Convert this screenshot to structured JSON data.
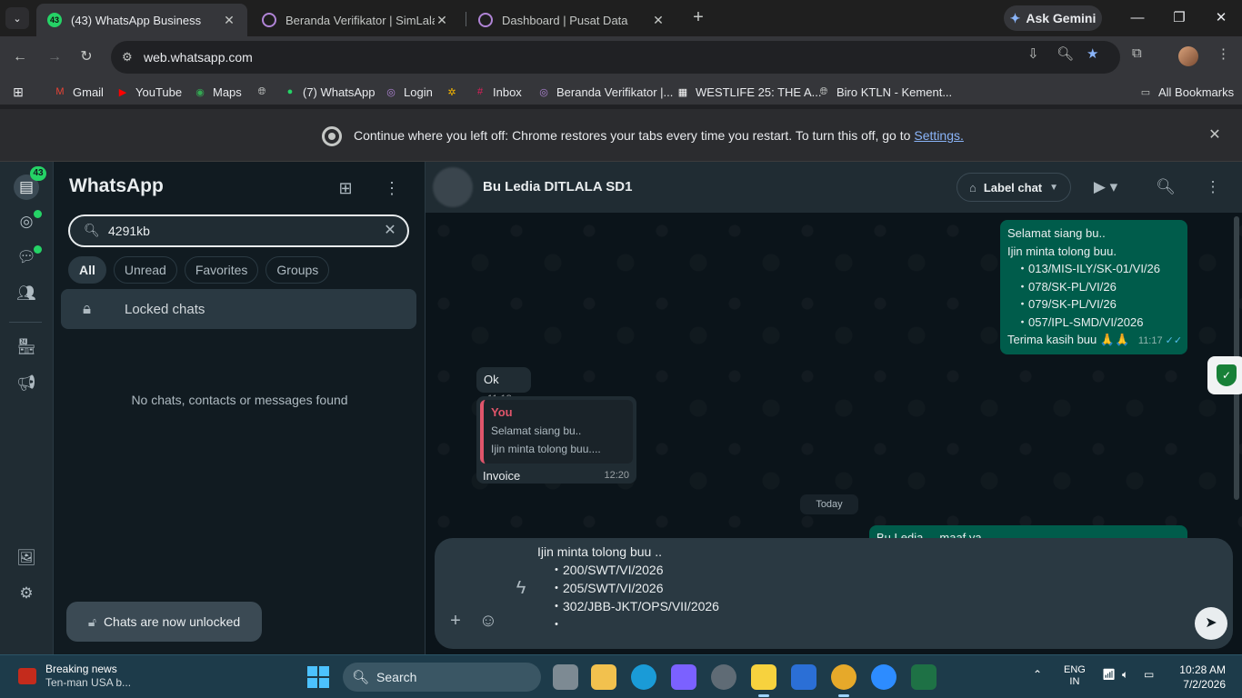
{
  "browser": {
    "tabs": [
      {
        "title": "(43) WhatsApp Business",
        "badge": "43",
        "active": true
      },
      {
        "title": "Beranda Verifikator | SimLala",
        "active": false
      },
      {
        "title": "Dashboard | Pusat Data",
        "active": false
      }
    ],
    "new_tab": "+",
    "ask_gemini": "Ask Gemini",
    "url": "web.whatsapp.com",
    "bookmarks": [
      {
        "label": "Gmail",
        "icon": "gmail-icon",
        "color": "#ea4335"
      },
      {
        "label": "YouTube",
        "icon": "youtube-icon",
        "color": "#ff0000"
      },
      {
        "label": "Maps",
        "icon": "maps-icon",
        "color": "#34a853"
      },
      {
        "label": "",
        "icon": "globe-icon",
        "color": "#c4c7c5"
      },
      {
        "label": "(7) WhatsApp",
        "icon": "whatsapp-icon",
        "color": "#25d366"
      },
      {
        "label": "Login",
        "icon": "simlala-icon",
        "color": "#9c27b0"
      },
      {
        "label": "",
        "icon": "pinwheel-icon",
        "color": "#f4b400"
      },
      {
        "label": "Inbox",
        "icon": "slack-icon",
        "color": "#e01e5a"
      },
      {
        "label": "Beranda Verifikator |...",
        "icon": "simlala-icon",
        "color": "#9c27b0"
      },
      {
        "label": "WESTLIFE 25: THE A...",
        "icon": "ticket-icon",
        "color": "#ffffff"
      },
      {
        "label": "Biro KTLN - Kement...",
        "icon": "globe-icon",
        "color": "#c4c7c5"
      }
    ],
    "all_bookmarks": "All Bookmarks",
    "infobar": {
      "message": "Continue where you left off: Chrome restores your tabs every time you restart. To turn this off, go to",
      "link": "Settings."
    }
  },
  "whatsapp": {
    "rail_badge": "43",
    "title": "WhatsApp",
    "search": {
      "value": "4291kb",
      "placeholder": "Search"
    },
    "filters": [
      "All",
      "Unread",
      "Favorites",
      "Groups"
    ],
    "locked_chats": "Locked chats",
    "no_results": "No chats, contacts or messages found",
    "toast": "Chats are now unlocked",
    "chat": {
      "contact": "Bu Ledia DITLALA SD1",
      "label_button": "Label chat",
      "messages": {
        "m1": {
          "lines": [
            "Selamat siang bu..",
            "Ijin minta tolong buu.",
            "・013/MIS-ILY/SK-01/VI/26",
            "・078/SK-PL/VI/26",
            "・079/SK-PL/VI/26",
            "・057/IPL-SMD/VI/2026",
            "Terima kasih buu 🙏🙏"
          ],
          "time": "11:17"
        },
        "m2": {
          "text": "Ok",
          "time": "11:18"
        },
        "m3": {
          "quote_author": "You",
          "quote_lines": [
            "Selamat siang bu..",
            "Ijin minta tolong buu...."
          ],
          "text": "Invoice",
          "time": "12:20"
        },
        "m4": {
          "text": "Bu Ledia ... maaf ya"
        }
      },
      "day_divider": "Today",
      "composer_lines": [
        "Ijin minta tolong buu ..",
        "・200/SWT/VI/2026",
        "・205/SWT/VI/2026",
        "・302/JBB-JKT/OPS/VII/2026",
        "・"
      ]
    }
  },
  "taskbar": {
    "news_title": "Breaking news",
    "news_sub": "Ten-man USA b...",
    "search_label": "Search",
    "lang_top": "ENG",
    "lang_bottom": "IN",
    "time": "10:28 AM",
    "date": "7/2/2026"
  }
}
